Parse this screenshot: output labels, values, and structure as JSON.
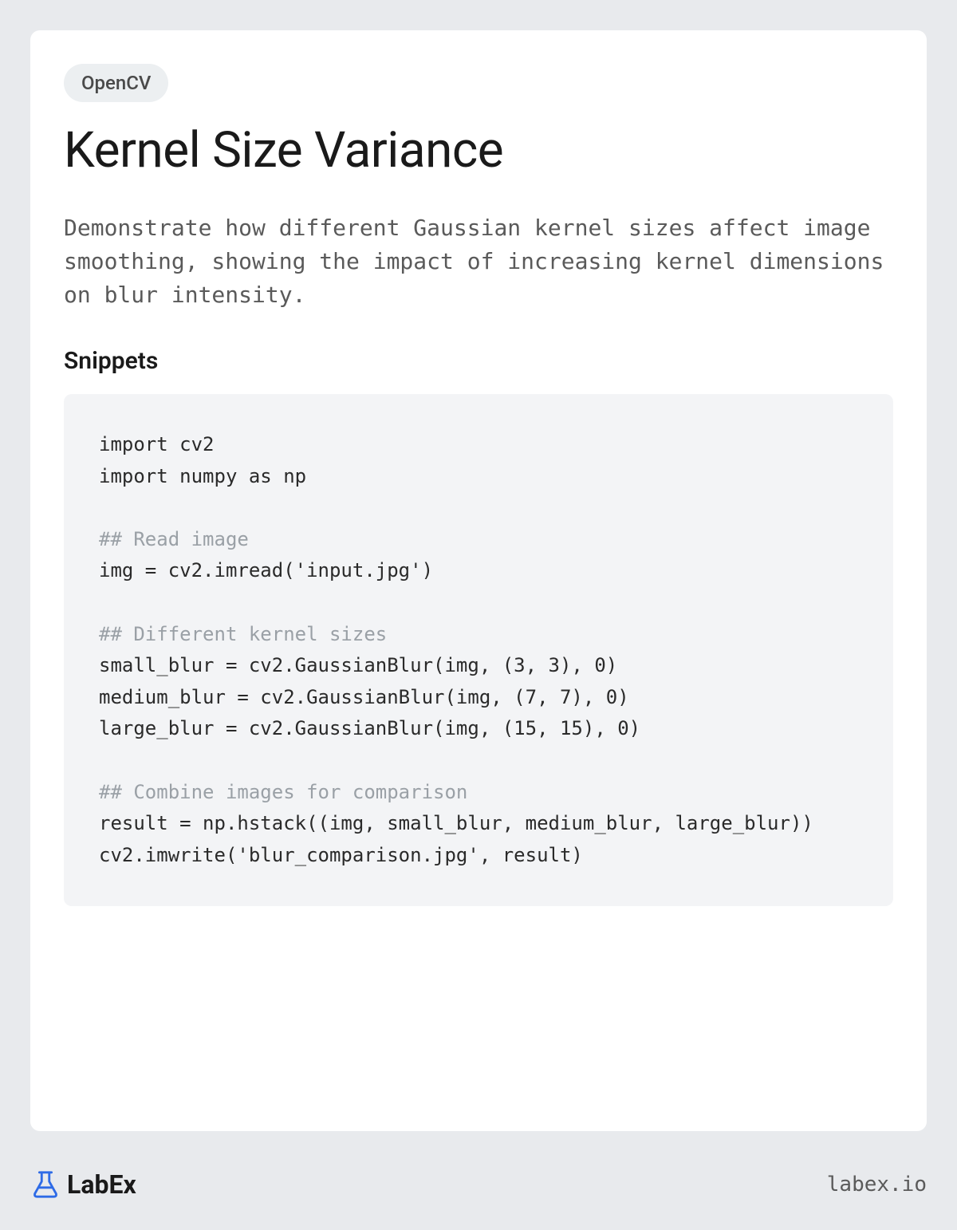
{
  "tag": "OpenCV",
  "title": "Kernel Size Variance",
  "description": "Demonstrate how different Gaussian kernel sizes affect image smoothing, showing the impact of increasing kernel dimensions on blur intensity.",
  "section_heading": "Snippets",
  "code": {
    "line1": "import cv2",
    "line2": "import numpy as np",
    "comment1": "## Read image",
    "line3": "img = cv2.imread('input.jpg')",
    "comment2": "## Different kernel sizes",
    "line4": "small_blur = cv2.GaussianBlur(img, (3, 3), 0)",
    "line5": "medium_blur = cv2.GaussianBlur(img, (7, 7), 0)",
    "line6": "large_blur = cv2.GaussianBlur(img, (15, 15), 0)",
    "comment3": "## Combine images for comparison",
    "line7": "result = np.hstack((img, small_blur, medium_blur, large_blur))",
    "line8": "cv2.imwrite('blur_comparison.jpg', result)"
  },
  "footer": {
    "logo_text": "LabEx",
    "url": "labex.io"
  }
}
